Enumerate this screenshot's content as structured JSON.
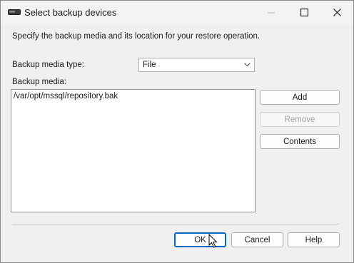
{
  "window": {
    "title": "Select backup devices"
  },
  "dialog": {
    "description": "Specify the backup media and its location for your restore operation.",
    "media_type_label": "Backup media type:",
    "media_type_value": "File",
    "media_label": "Backup media:",
    "media_items": [
      "/var/opt/mssql/repository.bak"
    ]
  },
  "buttons": {
    "add": "Add",
    "remove": "Remove",
    "contents": "Contents",
    "ok": "OK",
    "cancel": "Cancel",
    "help": "Help"
  },
  "icons": {
    "app": "backup-device-icon",
    "minimize": "minimize-icon",
    "maximize": "maximize-icon",
    "close": "close-icon",
    "dropdown": "chevron-down-icon",
    "cursor": "mouse-pointer-icon"
  },
  "colors": {
    "primary_border": "#0067c0",
    "window_bg": "#f0f0f0"
  }
}
